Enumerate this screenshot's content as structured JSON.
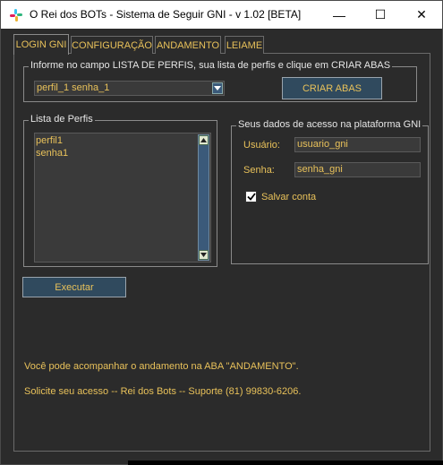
{
  "window": {
    "title": "O Rei dos BOTs - Sistema de Seguir GNI - v 1.02 [BETA]",
    "minimize_glyph": "—",
    "maximize_glyph": "☐",
    "close_glyph": "✕"
  },
  "tabs": [
    {
      "label": "LOGIN GNI",
      "active": true
    },
    {
      "label": "CONFIGURAÇÃO",
      "active": false
    },
    {
      "label": "ANDAMENTO",
      "active": false
    },
    {
      "label": "LEIAME",
      "active": false
    }
  ],
  "profiles_group": {
    "label": "Informe no campo LISTA DE PERFIS, sua lista de perfis e clique em CRIAR ABAS",
    "combo_value": "perfil_1 senha_1",
    "create_tabs_button": "CRIAR ABAS"
  },
  "profile_list": {
    "label": "Lista de Perfis",
    "lines": [
      "perfil1",
      "senha1"
    ]
  },
  "access": {
    "label": "Seus dados de acesso na plataforma GNI",
    "user_label": "Usuário:",
    "user_value": "usuario_gni",
    "password_label": "Senha:",
    "password_value": "senha_gni",
    "save_account_label": "Salvar conta",
    "save_account_checked": true
  },
  "execute_button": "Executar",
  "info": {
    "line1": "Você pode acompanhar o andamento na ABA \"ANDAMENTO\".",
    "line2": "Solicite seu acesso -- Rei dos Bots -- Suporte (81) 99830-6206."
  },
  "colors": {
    "background": "#2b2b2b",
    "accent_text": "#e8c15a",
    "button": "#304a5e",
    "scrollbar": "#3b5a7a"
  },
  "icons": {
    "app": "colorful-app-icon",
    "combo_arrow": "chevron-down-icon",
    "scroll_up": "triangle-up-icon",
    "scroll_down": "triangle-down-icon",
    "checkbox": "check-icon"
  }
}
